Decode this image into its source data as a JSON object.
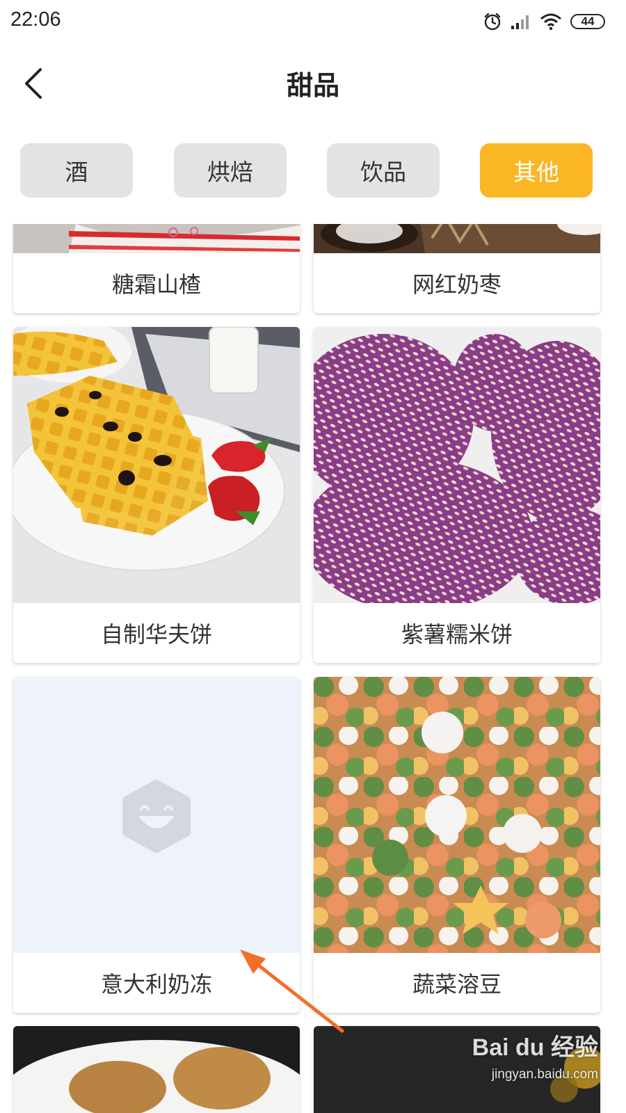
{
  "status_bar": {
    "time": "22:06",
    "battery": "44",
    "icons": [
      "alarm-icon",
      "signal-icon",
      "wifi-icon",
      "battery-icon"
    ]
  },
  "header": {
    "title": "甜品",
    "back_icon": "chevron-left-icon"
  },
  "tabs": [
    {
      "label": "酒",
      "active": false
    },
    {
      "label": "烘焙",
      "active": false
    },
    {
      "label": "饮品",
      "active": false
    },
    {
      "label": "其他",
      "active": true
    }
  ],
  "colors": {
    "accent": "#fbb623",
    "tab_bg": "#e3e3e3",
    "annotation_arrow": "#f36f2a"
  },
  "cards": [
    {
      "name": "糖霜山楂"
    },
    {
      "name": "网红奶枣"
    },
    {
      "name": "自制华夫饼"
    },
    {
      "name": "紫薯糯米饼"
    },
    {
      "name": "意大利奶冻"
    },
    {
      "name": "蔬菜溶豆"
    }
  ],
  "watermark": {
    "logo": "Bai du 经验",
    "url": "jingyan.baidu.com"
  }
}
